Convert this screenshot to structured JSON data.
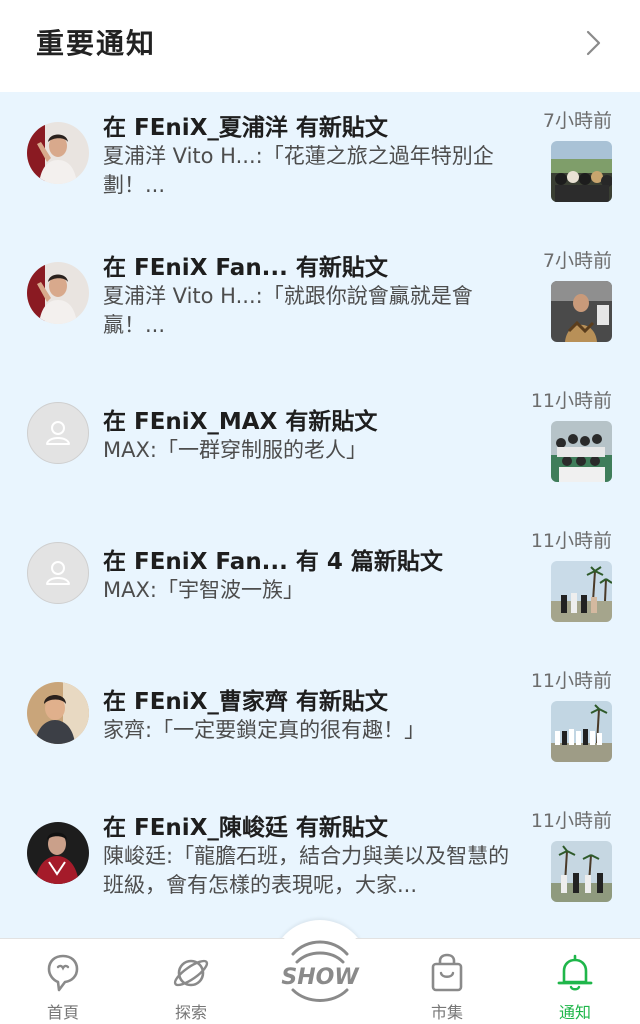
{
  "header": {
    "title": "重要通知"
  },
  "notifications": [
    {
      "title": "在 FEniX_夏浦洋 有新貼文",
      "desc": "夏浦洋 Vito H...:「花蓮之旅之過年特別企劃！...",
      "time": "7小時前"
    },
    {
      "title": "在 FEniX Fan... 有新貼文",
      "desc": "夏浦洋 Vito H...:「就跟你說會贏就是會贏！...",
      "time": "7小時前"
    },
    {
      "title": "在 FEniX_MAX 有新貼文",
      "desc": "MAX:「一群穿制服的老人」",
      "time": "11小時前"
    },
    {
      "title": "在 FEniX Fan... 有  4  篇新貼文",
      "desc": "MAX:「宇智波一族」",
      "time": "11小時前"
    },
    {
      "title": "在 FEniX_曹家齊 有新貼文",
      "desc": "家齊:「一定要鎖定真的很有趣！」",
      "time": "11小時前"
    },
    {
      "title": "在 FEniX_陳峻廷 有新貼文",
      "desc": "陳峻廷:「龍膽石班，結合力與美以及智慧的班級，會有怎樣的表現呢，大家...",
      "time": "11小時前"
    }
  ],
  "tabbar": {
    "items": [
      {
        "label": "首頁",
        "icon": "home-bubble-icon"
      },
      {
        "label": "探索",
        "icon": "planet-icon"
      },
      {
        "label": "SHOW",
        "icon": "show-icon"
      },
      {
        "label": "市集",
        "icon": "shopping-bag-icon"
      },
      {
        "label": "通知",
        "icon": "bell-icon"
      }
    ],
    "active_color": "#1fb64a",
    "inactive_color": "#777777"
  }
}
